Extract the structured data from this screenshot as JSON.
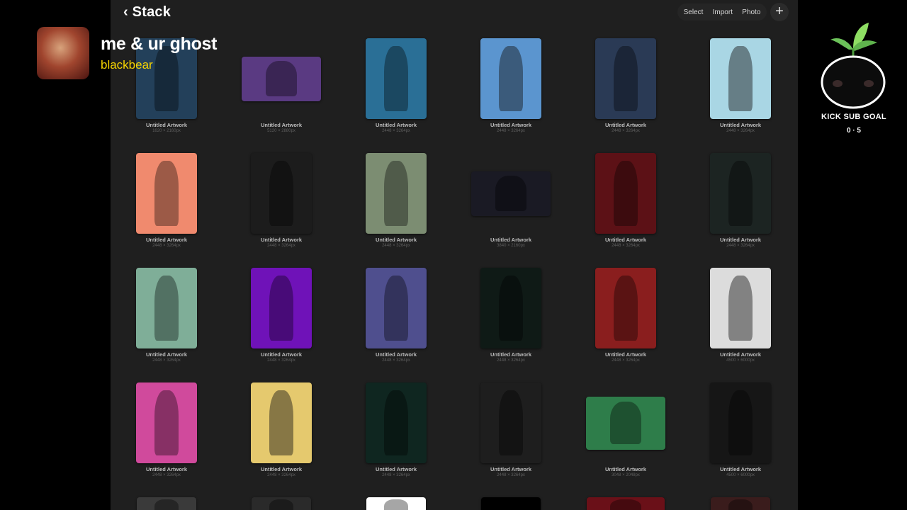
{
  "overlay": {
    "song_title": "me & ur ghost",
    "song_artist": "blackbear",
    "goal_label": "KICK SUB GOAL",
    "goal_count": "0 · 5",
    "mascot_icon": "sprout-mascot-icon"
  },
  "header": {
    "back_icon": "chevron-left-icon",
    "title": "Stack",
    "select_label": "Select",
    "import_label": "Import",
    "photo_label": "Photo",
    "add_icon": "plus-icon"
  },
  "artworks": [
    {
      "title": "Untitled Artwork",
      "dims": "1620 × 2160px",
      "color": "#23405a"
    },
    {
      "title": "Untitled Artwork",
      "dims": "5120 × 2880px",
      "color": "#5a3a82"
    },
    {
      "title": "Untitled Artwork",
      "dims": "2448 × 3264px",
      "color": "#2a6f96"
    },
    {
      "title": "Untitled Artwork",
      "dims": "2448 × 3264px",
      "color": "#5b95cf"
    },
    {
      "title": "Untitled Artwork",
      "dims": "2448 × 3264px",
      "color": "#2a3a55"
    },
    {
      "title": "Untitled Artwork",
      "dims": "2448 × 3264px",
      "color": "#a9d6e4"
    },
    {
      "title": "Untitled Artwork",
      "dims": "2448 × 3264px",
      "color": "#f08a6e"
    },
    {
      "title": "Untitled Artwork",
      "dims": "2448 × 3264px",
      "color": "#1c1c1c"
    },
    {
      "title": "Untitled Artwork",
      "dims": "2448 × 3264px",
      "color": "#7c8d72"
    },
    {
      "title": "Untitled Artwork",
      "dims": "3840 × 2160px",
      "color": "#1a1a24"
    },
    {
      "title": "Untitled Artwork",
      "dims": "2448 × 3264px",
      "color": "#5c1116"
    },
    {
      "title": "Untitled Artwork",
      "dims": "2448 × 3264px",
      "color": "#1c2422"
    },
    {
      "title": "Untitled Artwork",
      "dims": "2448 × 3264px",
      "color": "#7fae98"
    },
    {
      "title": "Untitled Artwork",
      "dims": "2448 × 3264px",
      "color": "#6f12b8"
    },
    {
      "title": "Untitled Artwork",
      "dims": "2448 × 3264px",
      "color": "#4f4f8e"
    },
    {
      "title": "Untitled Artwork",
      "dims": "2448 × 3264px",
      "color": "#0f1a16"
    },
    {
      "title": "Untitled Artwork",
      "dims": "2448 × 3264px",
      "color": "#8a1e1e"
    },
    {
      "title": "Untitled Artwork",
      "dims": "4500 × 6000px",
      "color": "#dcdcdc"
    },
    {
      "title": "Untitled Artwork",
      "dims": "2448 × 3264px",
      "color": "#d04a9c"
    },
    {
      "title": "Untitled Artwork",
      "dims": "2448 × 3264px",
      "color": "#e5c96e"
    },
    {
      "title": "Untitled Artwork",
      "dims": "2448 × 3264px",
      "color": "#0f2620"
    },
    {
      "title": "Untitled Artwork",
      "dims": "2448 × 3264px",
      "color": "#1e1e1e"
    },
    {
      "title": "Untitled Artwork",
      "dims": "3048 × 2048px",
      "color": "#2e7d4a"
    },
    {
      "title": "Untitled Artwork",
      "dims": "4500 × 6000px",
      "color": "#161616"
    }
  ],
  "partial_row_colors": [
    "#3a3a3a",
    "#2a2a2a",
    "#ffffff",
    "#000000",
    "#6a1018",
    "#3a1c1c"
  ]
}
